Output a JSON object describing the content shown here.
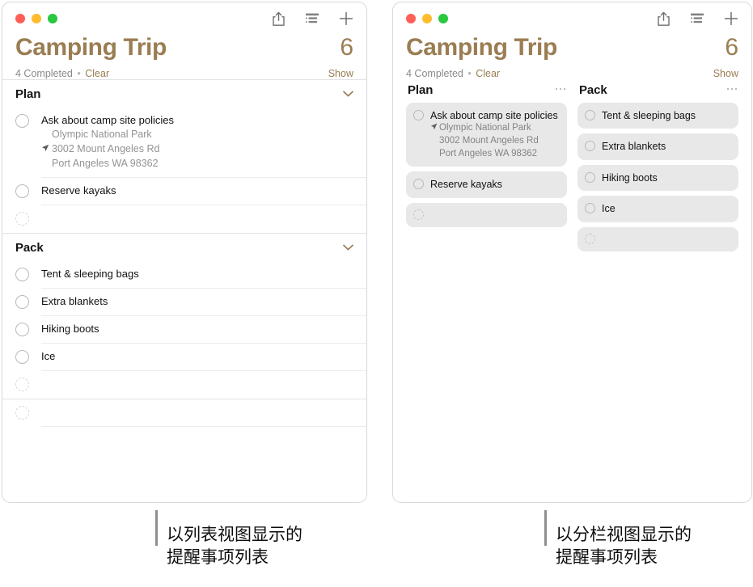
{
  "window_list": {
    "traffic_lights": {
      "close": "close",
      "minimize": "minimize",
      "zoom": "zoom"
    },
    "toolbar": {
      "share_label": "share-icon",
      "list_view_label": "list-format-icon",
      "add_label": "add-icon"
    },
    "header": {
      "title": "Camping Trip",
      "count": "6",
      "completed_text": "4 Completed",
      "separator": "•",
      "clear_label": "Clear",
      "show_label": "Show"
    },
    "sections": [
      {
        "name": "Plan",
        "collapse_icon": "chevron-down-icon",
        "tasks": [
          {
            "title": "Ask about camp site policies",
            "sub_lines": [
              {
                "text": "Olympic National Park",
                "icon": false
              },
              {
                "text": "3002 Mount Angeles Rd",
                "icon": true
              },
              {
                "text": "Port Angeles WA 98362",
                "icon": false
              }
            ]
          },
          {
            "title": "Reserve kayaks",
            "sub_lines": []
          }
        ],
        "new_item_placeholder": ""
      },
      {
        "name": "Pack",
        "collapse_icon": "chevron-down-icon",
        "tasks": [
          {
            "title": "Tent & sleeping bags",
            "sub_lines": []
          },
          {
            "title": "Extra blankets",
            "sub_lines": []
          },
          {
            "title": "Hiking boots",
            "sub_lines": []
          },
          {
            "title": "Ice",
            "sub_lines": []
          }
        ],
        "new_item_placeholder": ""
      }
    ],
    "trailing_new_item_placeholder": ""
  },
  "window_column": {
    "traffic_lights": {
      "close": "close",
      "minimize": "minimize",
      "zoom": "zoom"
    },
    "toolbar": {
      "share_label": "share-icon",
      "list_view_label": "list-format-icon",
      "add_label": "add-icon"
    },
    "header": {
      "title": "Camping Trip",
      "count": "6",
      "completed_text": "4 Completed",
      "separator": "•",
      "clear_label": "Clear",
      "show_label": "Show"
    },
    "columns": [
      {
        "name": "Plan",
        "more_icon": "ellipsis-icon",
        "cards": [
          {
            "title": "Ask about camp site policies",
            "sub_lines": [
              {
                "text": "Olympic National Park",
                "icon": true
              },
              {
                "text": "3002 Mount Angeles Rd",
                "icon": false
              },
              {
                "text": "Port Angeles WA 98362",
                "icon": false
              }
            ]
          },
          {
            "title": "Reserve kayaks",
            "sub_lines": []
          }
        ],
        "new_card_placeholder": ""
      },
      {
        "name": "Pack",
        "more_icon": "ellipsis-icon",
        "cards": [
          {
            "title": "Tent & sleeping bags",
            "sub_lines": []
          },
          {
            "title": "Extra blankets",
            "sub_lines": []
          },
          {
            "title": "Hiking boots",
            "sub_lines": []
          },
          {
            "title": "Ice",
            "sub_lines": []
          }
        ],
        "new_card_placeholder": ""
      }
    ]
  },
  "captions": {
    "list_view": "以列表视图显示的\n提醒事项列表",
    "column_view": "以分栏视图显示的\n提醒事项列表"
  },
  "colors": {
    "accent_tan": "#9a7d52",
    "traffic_close": "#ff5f57",
    "traffic_minimize": "#febc2e",
    "traffic_zoom": "#28c840",
    "card_background": "#e8e8e8",
    "text_primary": "#111111",
    "text_secondary": "#939396"
  }
}
